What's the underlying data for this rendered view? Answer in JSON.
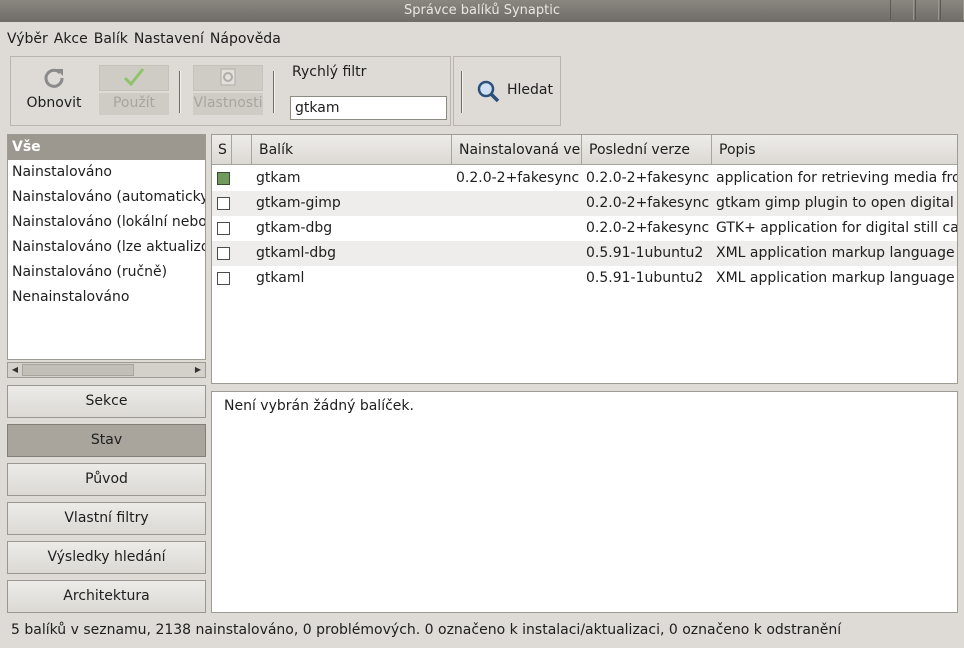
{
  "window": {
    "title": "Správce balíků Synaptic"
  },
  "menu": [
    "Výběr",
    "Akce",
    "Balík",
    "Nastavení",
    "Nápověda"
  ],
  "toolbar": {
    "reload_label": "Obnovit",
    "apply_label": "Použít",
    "properties_label": "Vlastnosti",
    "quick_filter_label": "Rychlý filtr",
    "quick_filter_value": "gtkam",
    "search_label": "Hledat"
  },
  "filters": {
    "items": [
      "Vše",
      "Nainstalováno",
      "Nainstalováno (automaticky)",
      "Nainstalováno (lokální nebo zastaralé)",
      "Nainstalováno (lze aktualizovat)",
      "Nainstalováno (ručně)",
      "Nenainstalováno"
    ],
    "selected_index": 0
  },
  "side_buttons": {
    "sections": "Sekce",
    "status": "Stav",
    "origin": "Původ",
    "custom_filters": "Vlastní filtry",
    "search_results": "Výsledky hledání",
    "architecture": "Architektura"
  },
  "table": {
    "columns": {
      "s": "S",
      "package": "Balík",
      "installed_version": "Nainstalovaná verze",
      "latest_version": "Poslední verze",
      "description": "Popis"
    },
    "rows": [
      {
        "name": "gtkam",
        "installed": "0.2.0-2+fakesync",
        "latest": "0.2.0-2+fakesync",
        "description": "application for retrieving media from digital cameras",
        "is_installed": true
      },
      {
        "name": "gtkam-gimp",
        "installed": "",
        "latest": "0.2.0-2+fakesync",
        "description": "gtkam gimp plugin to open digital camera pictures",
        "is_installed": false
      },
      {
        "name": "gtkam-dbg",
        "installed": "",
        "latest": "0.2.0-2+fakesync",
        "description": "GTK+ application for digital still camera",
        "is_installed": false
      },
      {
        "name": "gtkaml-dbg",
        "installed": "",
        "latest": "0.5.91-1ubuntu2",
        "description": "XML application markup language for GTK+",
        "is_installed": false
      },
      {
        "name": "gtkaml",
        "installed": "",
        "latest": "0.5.91-1ubuntu2",
        "description": "XML application markup language for GTK+",
        "is_installed": false
      }
    ]
  },
  "details": {
    "text": "Není vybrán žádný balíček."
  },
  "status": {
    "text": "5 balíků v seznamu, 2138 nainstalováno, 0 problémových. 0 označeno k instalaci/aktualizaci, 0 označeno k odstranění"
  }
}
